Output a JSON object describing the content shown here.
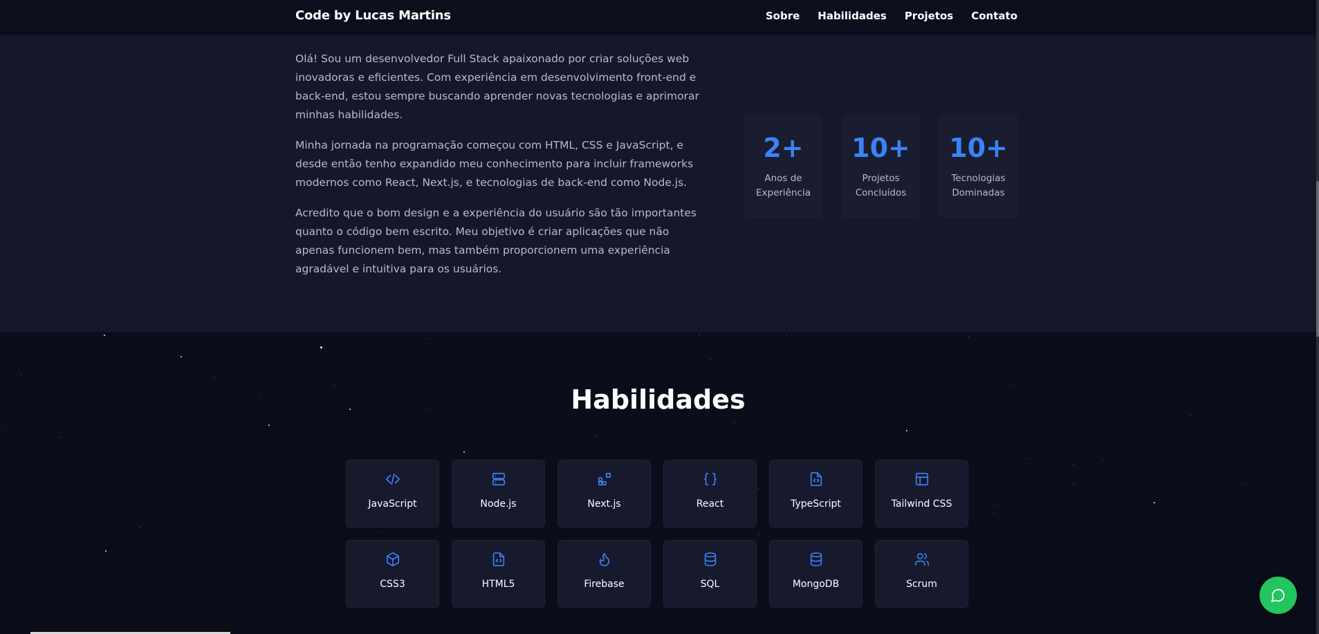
{
  "header": {
    "brand": "Code by Lucas Martins",
    "nav": [
      "Sobre",
      "Habilidades",
      "Projetos",
      "Contato"
    ]
  },
  "about": {
    "paragraphs": [
      "Olá! Sou um desenvolvedor Full Stack apaixonado por criar soluções web inovadoras e eficientes. Com experiência em desenvolvimento front-end e back-end, estou sempre buscando aprender novas tecnologias e aprimorar minhas habilidades.",
      "Minha jornada na programação começou com HTML, CSS e JavaScript, e desde então tenho expandido meu conhecimento para incluir frameworks modernos como React, Next.js, e tecnologias de back-end como Node.js.",
      "Acredito que o bom design e a experiência do usuário são tão importantes quanto o código bem escrito. Meu objetivo é criar aplicações que não apenas funcionem bem, mas também proporcionem uma experiência agradável e intuitiva para os usuários."
    ],
    "stats": [
      {
        "value": "2+",
        "label_line1": "Anos de",
        "label_line2": "Experiência"
      },
      {
        "value": "10+",
        "label_line1": "Projetos",
        "label_line2": "Concluídos"
      },
      {
        "value": "10+",
        "label_line1": "Tecnologias",
        "label_line2": "Dominadas"
      }
    ]
  },
  "skills": {
    "title": "Habilidades",
    "items": [
      {
        "name": "JavaScript",
        "icon": "code-icon"
      },
      {
        "name": "Node.js",
        "icon": "server-icon"
      },
      {
        "name": "Next.js",
        "icon": "blocks-icon"
      },
      {
        "name": "React",
        "icon": "braces-icon"
      },
      {
        "name": "TypeScript",
        "icon": "file-code-icon"
      },
      {
        "name": "Tailwind CSS",
        "icon": "layout-icon"
      },
      {
        "name": "CSS3",
        "icon": "box-icon"
      },
      {
        "name": "HTML5",
        "icon": "file-code-icon"
      },
      {
        "name": "Firebase",
        "icon": "flame-icon"
      },
      {
        "name": "SQL",
        "icon": "database-icon"
      },
      {
        "name": "MongoDB",
        "icon": "database-icon"
      },
      {
        "name": "Scrum",
        "icon": "users-icon"
      }
    ]
  },
  "chat": {
    "icon": "message-circle-icon"
  },
  "colors": {
    "accent": "#3b82f6",
    "chat": "#22c55e",
    "background": "#0b0e1a",
    "section": "#141829"
  }
}
